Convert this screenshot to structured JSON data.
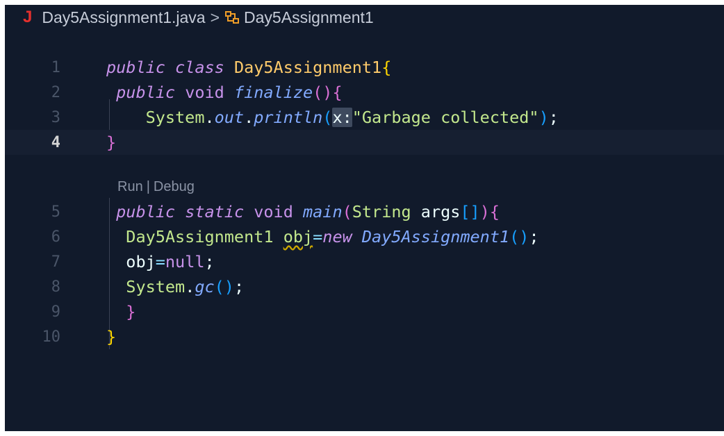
{
  "breadcrumb": {
    "java_icon": "J",
    "file": "Day5Assignment1.java",
    "separator": ">",
    "class_icon": "class-symbol-icon",
    "class": "Day5Assignment1"
  },
  "codelens": {
    "run": "Run",
    "divider": "|",
    "debug": "Debug"
  },
  "lines": {
    "l1": {
      "num": "1",
      "kw1": "public",
      "kw2": "class",
      "name": "Day5Assignment1",
      "brace": "{"
    },
    "l2": {
      "num": "2",
      "kw1": "public",
      "kw2": "void",
      "fn": "finalize",
      "paren": "()",
      "brace": "{"
    },
    "l3": {
      "num": "3",
      "sys": "System",
      "dot1": ".",
      "out": "out",
      "dot2": ".",
      "fn": "println",
      "open": "(",
      "hint": "x:",
      "str": "\"Garbage collected\"",
      "close": ")",
      "semi": ";"
    },
    "l4": {
      "num": "4",
      "brace": "}"
    },
    "l5": {
      "num": "5",
      "kw1": "public",
      "kw2": "static",
      "kw3": "void",
      "fn": "main",
      "open": "(",
      "type": "String",
      "arg": "args",
      "brackets": "[]",
      "close": ")",
      "brace": "{"
    },
    "l6": {
      "num": "6",
      "type": "Day5Assignment1",
      "var": "obj",
      "eq": "=",
      "newkw": "new",
      "ctor": "Day5Assignment1",
      "parens": "()",
      "semi": ";"
    },
    "l7": {
      "num": "7",
      "var": "obj",
      "eq": "=",
      "nul": "null",
      "semi": ";"
    },
    "l8": {
      "num": "8",
      "sys": "System",
      "dot": ".",
      "fn": "gc",
      "parens": "()",
      "semi": ";"
    },
    "l9": {
      "num": "9",
      "brace": "}"
    },
    "l10": {
      "num": "10",
      "brace": "}"
    }
  },
  "colors": {
    "background": "#111a2b",
    "keyword": "#c792ea",
    "class": "#ffcb6b",
    "function": "#82aaff",
    "string": "#c3e88d",
    "java_icon": "#e5302d"
  }
}
